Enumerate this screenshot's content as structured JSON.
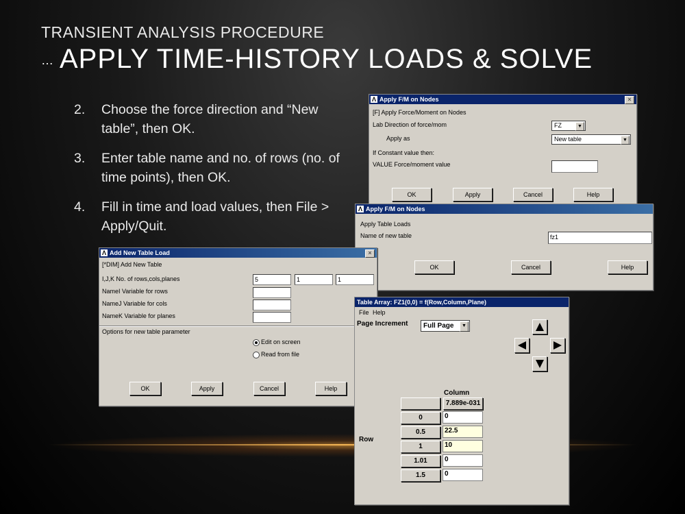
{
  "slide": {
    "subtitle": "TRANSIENT ANALYSIS PROCEDURE",
    "title_prefix": "…",
    "title": "APPLY TIME-HISTORY LOADS & SOLVE",
    "bullets": [
      {
        "num": "2.",
        "text": "Choose the force direction and “New table”, then OK."
      },
      {
        "num": "3.",
        "text": "Enter table name and no. of rows (no. of time points), then OK."
      },
      {
        "num": "4.",
        "text": "Fill in time and load values, then File > Apply/Quit."
      }
    ]
  },
  "dialog1": {
    "title": "Apply F/M on Nodes",
    "close": "×",
    "header": "[F]  Apply Force/Moment on Nodes",
    "lab_label": "Lab     Direction of force/mom",
    "lab_value": "FZ",
    "apply_as_label": "Apply as",
    "apply_as_value": "New table",
    "constant_label": "If Constant value then:",
    "value_label": "VALUE  Force/moment value",
    "value_field": "",
    "buttons": {
      "ok": "OK",
      "apply": "Apply",
      "cancel": "Cancel",
      "help": "Help"
    }
  },
  "dialog2": {
    "title": "Apply F/M on Nodes",
    "header": "Apply Table Loads",
    "name_label": "Name of new table",
    "name_value": "fz1",
    "buttons": {
      "ok": "OK",
      "cancel": "Cancel",
      "help": "Help"
    }
  },
  "dialog3": {
    "title": "Add New Table Load",
    "close": "×",
    "header": "[*DIM] Add New Table",
    "ijk_label": "I,J,K   No. of rows,cols,planes",
    "ijk_values": [
      "5",
      "1",
      "1"
    ],
    "namei_label": "NameI   Variable for rows",
    "namej_label": "NameJ   Variable for cols",
    "namek_label": "NameK   Variable for planes",
    "options_label": "Options for new table parameter",
    "radio_edit": "Edit on screen",
    "radio_read": "Read from file",
    "buttons": {
      "ok": "OK",
      "apply": "Apply",
      "cancel": "Cancel",
      "help": "Help"
    }
  },
  "table_window": {
    "title": "Table Array: FZ1(0,0) = f(Row,Column,Plane)",
    "menu": {
      "file": "File",
      "help": "Help"
    },
    "page_increment_label": "Page Increment",
    "page_increment_value": "Full Page",
    "column_label": "Column",
    "column_header": "7.889e-031",
    "row_label": "Row",
    "rows": [
      {
        "key": "0",
        "value": "0"
      },
      {
        "key": "0.5",
        "value": "22.5"
      },
      {
        "key": "1",
        "value": "10"
      },
      {
        "key": "1.01",
        "value": "0"
      },
      {
        "key": "1.5",
        "value": "0"
      }
    ]
  }
}
